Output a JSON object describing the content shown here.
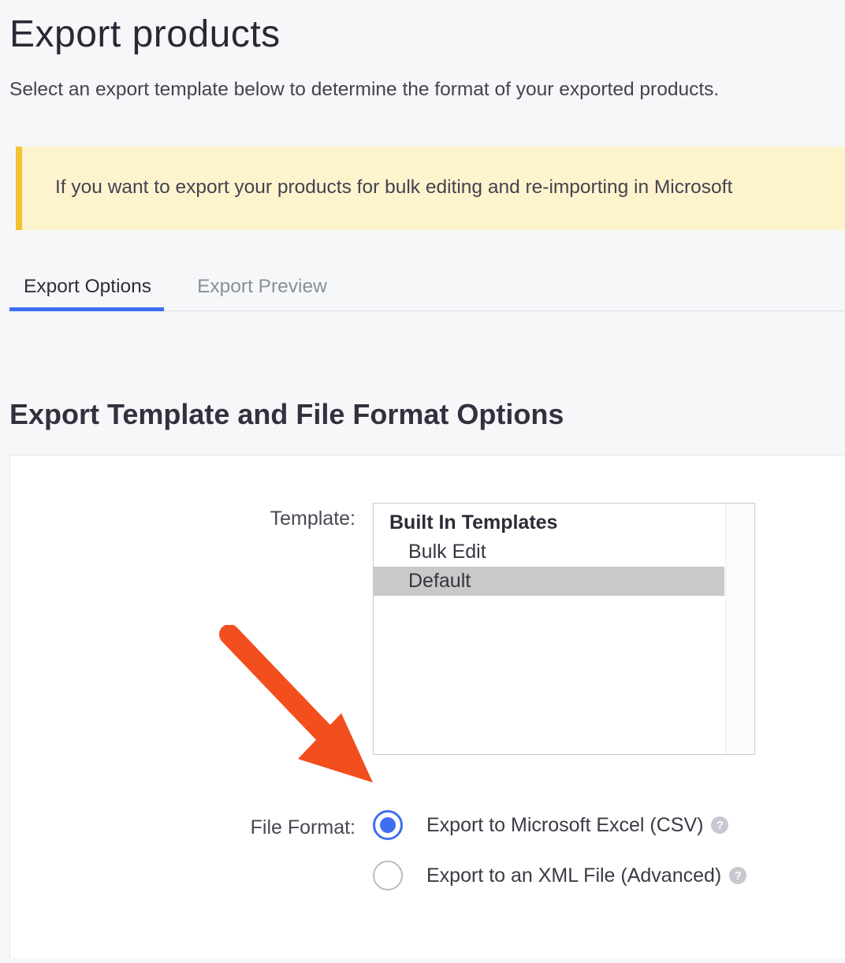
{
  "page_title": "Export products",
  "subtitle": "Select an export template below to determine the format of your exported products. ",
  "notice": "If you want to export your products for bulk editing and re-importing in Microsoft",
  "tabs": [
    {
      "label": "Export Options",
      "active": true
    },
    {
      "label": "Export Preview",
      "active": false
    }
  ],
  "section_title": "Export Template and File Format Options",
  "form": {
    "template": {
      "label": "Template:",
      "group_label": "Built In Templates",
      "options": [
        {
          "label": "Bulk Edit",
          "selected": false
        },
        {
          "label": "Default",
          "selected": true
        }
      ]
    },
    "file_format": {
      "label": "File Format:",
      "options": [
        {
          "label": "Export to Microsoft Excel (CSV)",
          "checked": true
        },
        {
          "label": "Export to an XML File (Advanced)",
          "checked": false
        }
      ]
    }
  }
}
